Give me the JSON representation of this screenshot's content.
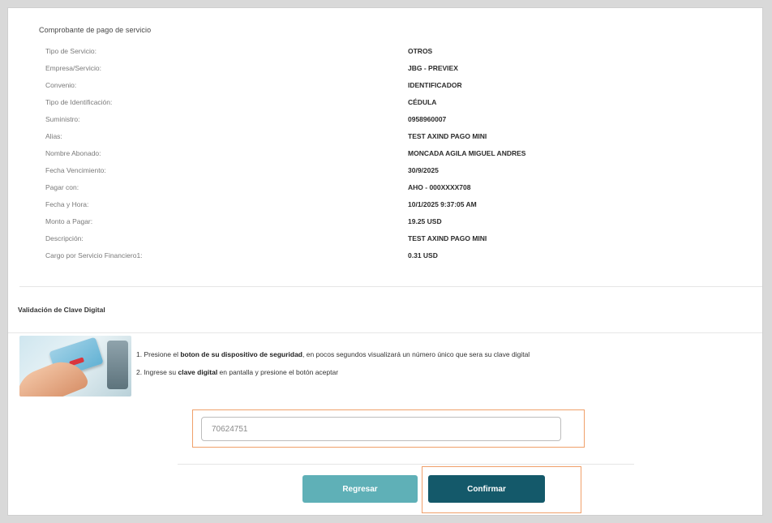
{
  "receipt": {
    "title": "Comprobante de pago de servicio",
    "rows": [
      {
        "label": "Tipo de Servicio:",
        "value": "OTROS"
      },
      {
        "label": "Empresa/Servicio:",
        "value": "JBG - PREVIEX"
      },
      {
        "label": "Convenio:",
        "value": "IDENTIFICADOR"
      },
      {
        "label": "Tipo de Identificación:",
        "value": "CÉDULA"
      },
      {
        "label": "Suministro:",
        "value": "0958960007"
      },
      {
        "label": "Alias:",
        "value": "TEST AXIND PAGO MINI"
      },
      {
        "label": "Nombre Abonado:",
        "value": "MONCADA AGILA MIGUEL ANDRES"
      },
      {
        "label": "Fecha Vencimiento:",
        "value": "30/9/2025"
      },
      {
        "label": "Pagar con:",
        "value": "AHO - 000XXXX708"
      },
      {
        "label": "Fecha y Hora:",
        "value": "10/1/2025 9:37:05 AM"
      },
      {
        "label": "Monto a Pagar:",
        "value": "19.25 USD"
      },
      {
        "label": "Descripción:",
        "value": "TEST AXIND PAGO MINI"
      },
      {
        "label": "Cargo por Servicio Financiero1:",
        "value": "0.31 USD"
      }
    ]
  },
  "validation": {
    "title": "Validación de Clave Digital",
    "step1": {
      "prefix": "1. Presione el ",
      "bold": "boton de su dispositivo de seguridad",
      "suffix": ", en pocos segundos visualizará un número único que sera su clave digital"
    },
    "step2": {
      "prefix": "2. Ingrese su ",
      "bold": "clave digital",
      "suffix": " en pantalla y presione el botón aceptar"
    },
    "code_value": "70624751"
  },
  "actions": {
    "back_label": "Regresar",
    "confirm_label": "Confirmar"
  },
  "colors": {
    "back_button": "#5fb0b7",
    "confirm_button": "#14596a",
    "highlight": "#f0a06a"
  }
}
